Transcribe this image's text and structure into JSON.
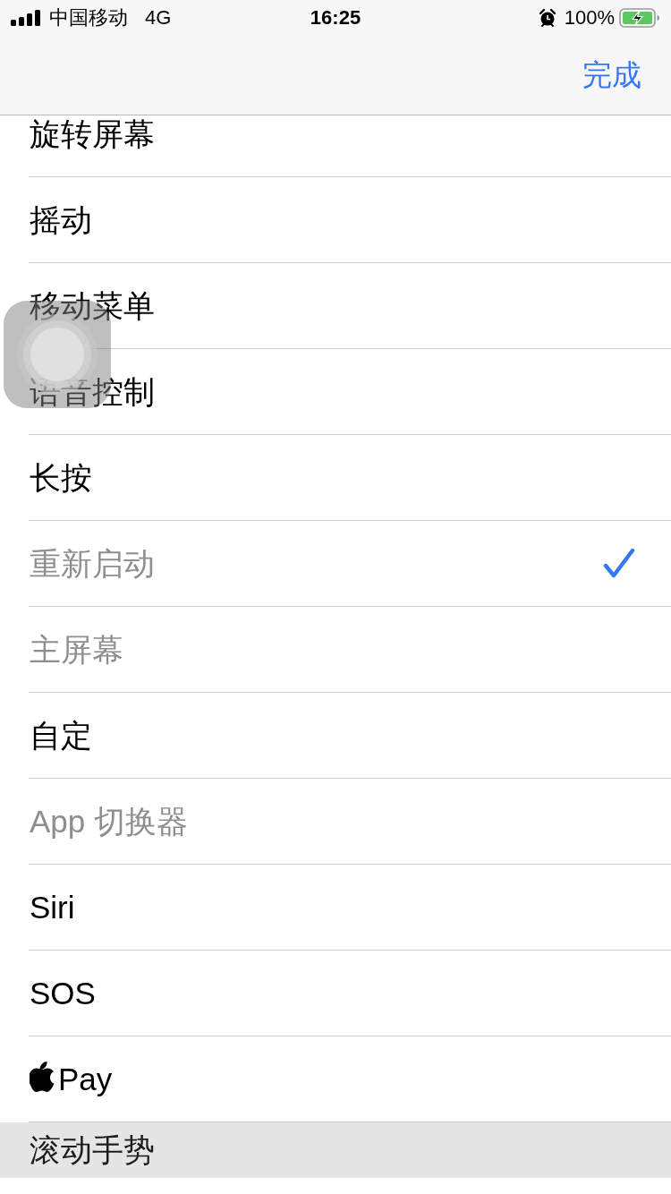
{
  "status_bar": {
    "carrier": "中国移动",
    "network": "4G",
    "time": "16:25",
    "battery": "100%"
  },
  "nav_bar": {
    "done_button": "完成"
  },
  "list": {
    "items": [
      {
        "kind": "text",
        "label": "旋转屏幕",
        "disabled": false,
        "selected": false
      },
      {
        "kind": "text",
        "label": "摇动",
        "disabled": false,
        "selected": false
      },
      {
        "kind": "text",
        "label": "移动菜单",
        "disabled": false,
        "selected": false
      },
      {
        "kind": "text",
        "label": "语音控制",
        "disabled": false,
        "selected": false
      },
      {
        "kind": "text",
        "label": "长按",
        "disabled": false,
        "selected": false
      },
      {
        "kind": "text",
        "label": "重新启动",
        "disabled": true,
        "selected": true
      },
      {
        "kind": "text",
        "label": "主屏幕",
        "disabled": true,
        "selected": false
      },
      {
        "kind": "text",
        "label": "自定",
        "disabled": false,
        "selected": false
      },
      {
        "kind": "text",
        "label": "App 切换器",
        "disabled": true,
        "selected": false
      },
      {
        "kind": "text",
        "label": "Siri",
        "disabled": false,
        "selected": false
      },
      {
        "kind": "text",
        "label": "SOS",
        "disabled": false,
        "selected": false
      },
      {
        "kind": "apple_logo",
        "label": "Pay",
        "disabled": false,
        "selected": false
      }
    ]
  },
  "section_header": {
    "title": "滚动手势"
  }
}
